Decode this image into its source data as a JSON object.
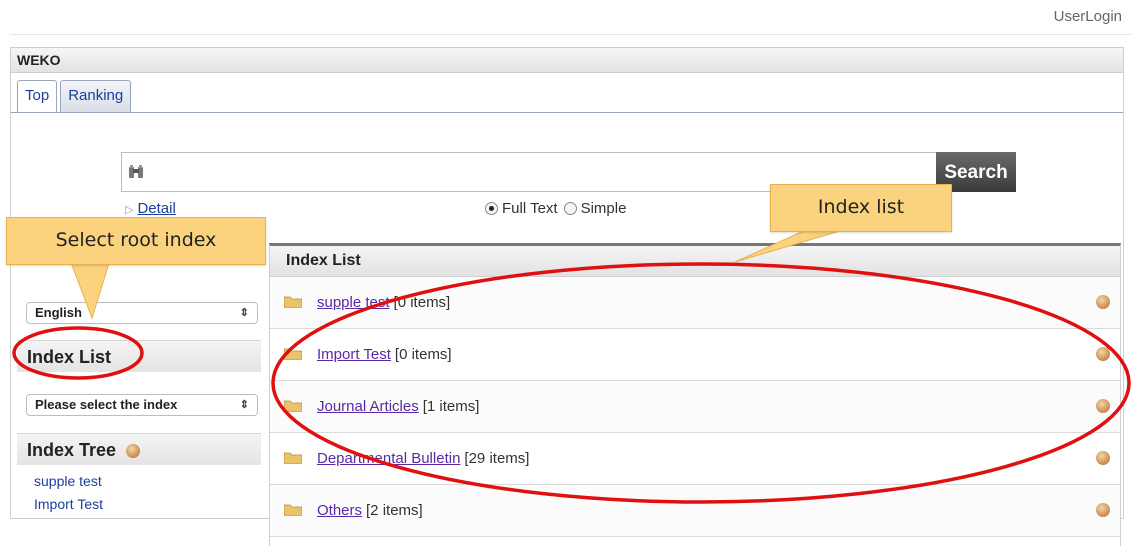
{
  "header": {
    "user_login": "UserLogin"
  },
  "frame": {
    "title": "WEKO"
  },
  "tabs": [
    {
      "label": "Top"
    },
    {
      "label": "Ranking"
    }
  ],
  "search": {
    "value": "",
    "button_label": "Search",
    "detail_link": "Detail",
    "modes": [
      {
        "label": "Full Text",
        "checked": true
      },
      {
        "label": "Simple",
        "checked": false
      }
    ]
  },
  "left": {
    "language_select": "English",
    "index_list_heading": "Index List",
    "index_select": "Please select the index",
    "index_tree_heading": "Index Tree",
    "tree_items": [
      "supple test",
      "Import Test"
    ]
  },
  "panel": {
    "heading": "Index List",
    "rows": [
      {
        "name": "supple test",
        "count": "[0 items]"
      },
      {
        "name": "Import Test",
        "count": "[0 items]"
      },
      {
        "name": "Journal Articles",
        "count": "[1 items]"
      },
      {
        "name": "Departmental Bulletin",
        "count": "[29 items]"
      },
      {
        "name": "Others",
        "count": "[2 items]"
      }
    ]
  },
  "callouts": {
    "left": "Select root index",
    "right": "Index list"
  },
  "colors": {
    "callout_fill": "#fbd27e",
    "annotation_red": "#e01010",
    "link": "#1a3e9c",
    "visited_link": "#5a2aa5"
  }
}
